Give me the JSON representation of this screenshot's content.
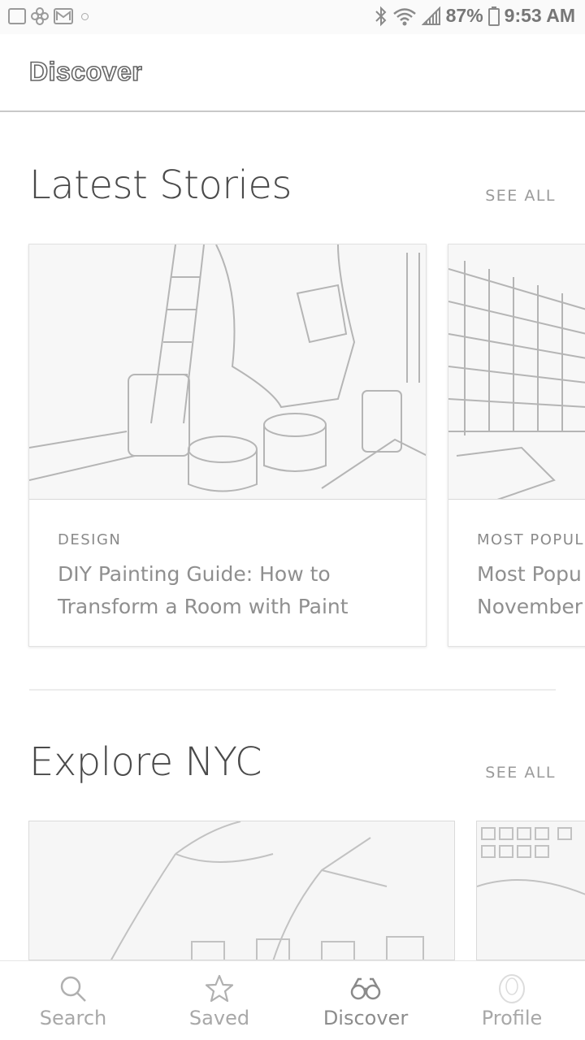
{
  "status_bar": {
    "battery": "87%",
    "time": "9:53 AM",
    "icons": [
      "image-notification-icon",
      "flower-notification-icon",
      "gmail-icon",
      "dot-icon",
      "bluetooth-icon",
      "wifi-icon",
      "signal-icon",
      "battery-icon"
    ]
  },
  "app_bar": {
    "title": "Discover"
  },
  "latest": {
    "title": "Latest Stories",
    "see_all": "SEE ALL",
    "cards": [
      {
        "category": "DESIGN",
        "title_line1": "DIY Painting Guide: How to",
        "title_line2": "Transform a Room with Paint",
        "image_icon": "painting-photo"
      },
      {
        "category": "MOST POPUL",
        "title_line1": "Most Popu",
        "title_line2": "November",
        "image_icon": "bookshelf-photo"
      }
    ]
  },
  "explore": {
    "title": "Explore NYC",
    "see_all": "SEE ALL",
    "photos": [
      {
        "image_icon": "tree-street-photo"
      },
      {
        "image_icon": "building-photo"
      }
    ]
  },
  "bottom_nav": {
    "active": "Discover",
    "items": [
      {
        "label": "Search",
        "icon": "search-icon"
      },
      {
        "label": "Saved",
        "icon": "star-icon"
      },
      {
        "label": "Discover",
        "icon": "binoculars-icon"
      },
      {
        "label": "Profile",
        "icon": "profile-icon"
      }
    ]
  }
}
